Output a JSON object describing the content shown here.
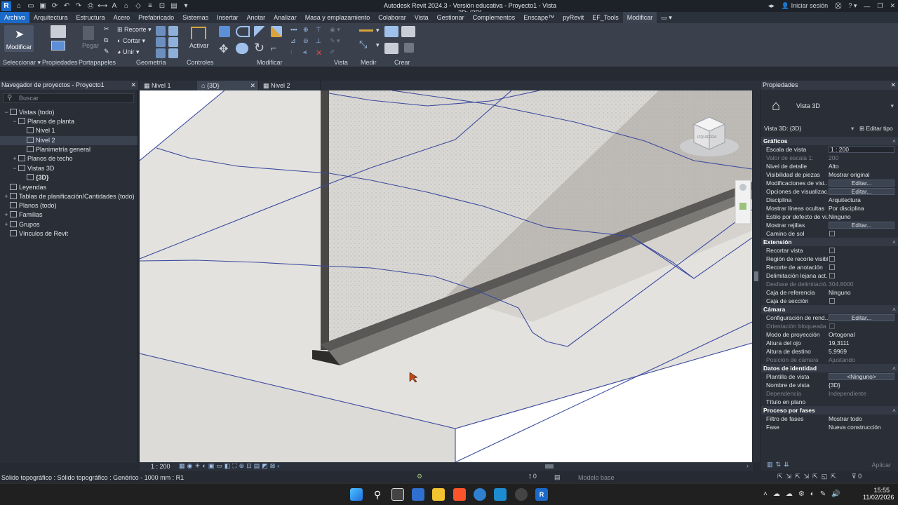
{
  "app": {
    "title": "Autodesk Revit 2024.3 - Versión educativa - Proyecto1 - Vista 3D: {3D}",
    "logo": "R",
    "signin": "Iniciar sesión"
  },
  "menu": [
    "Archivo",
    "Arquitectura",
    "Estructura",
    "Acero",
    "Prefabricado",
    "Sistemas",
    "Insertar",
    "Anotar",
    "Analizar",
    "Masa y emplazamiento",
    "Colaborar",
    "Vista",
    "Gestionar",
    "Complementos",
    "Enscape™",
    "pyRevit",
    "EF_Tools",
    "Modificar"
  ],
  "ribbon": {
    "modify_label": "Modificar",
    "paste_label": "Pegar",
    "cope_label": "Recorte",
    "cut_label": "Cortar",
    "join_label": "Unir",
    "activate_label": "Activar",
    "panels": [
      "Seleccionar",
      "Propiedades",
      "Portapapeles",
      "Geometría",
      "Controles",
      "Modificar",
      "Vista",
      "Medir",
      "Crear"
    ]
  },
  "browser": {
    "title": "Navegador de proyectos - Proyecto1",
    "search_placeholder": "Buscar",
    "items": [
      {
        "label": "Vistas (todo)",
        "toggle": "−",
        "indent": 0
      },
      {
        "label": "Planos de planta",
        "toggle": "−",
        "indent": 1
      },
      {
        "label": "Nivel 1",
        "toggle": "",
        "indent": 2
      },
      {
        "label": "Nivel 2",
        "toggle": "",
        "indent": 2
      },
      {
        "label": "Planimetría general",
        "toggle": "",
        "indent": 2
      },
      {
        "label": "Planos de techo",
        "toggle": "+",
        "indent": 1
      },
      {
        "label": "Vistas 3D",
        "toggle": "−",
        "indent": 1
      },
      {
        "label": "{3D}",
        "toggle": "",
        "indent": 2
      },
      {
        "label": "Leyendas",
        "toggle": "",
        "indent": 0
      },
      {
        "label": "Tablas de planificación/Cantidades (todo)",
        "toggle": "+",
        "indent": 0
      },
      {
        "label": "Planos (todo)",
        "toggle": "",
        "indent": 0
      },
      {
        "label": "Familias",
        "toggle": "+",
        "indent": 0
      },
      {
        "label": "Grupos",
        "toggle": "+",
        "indent": 0
      },
      {
        "label": "Vínculos de Revit",
        "toggle": "",
        "indent": 0
      }
    ]
  },
  "tabs": [
    {
      "label": "Nivel 1"
    },
    {
      "label": "{3D}"
    },
    {
      "label": "Nivel 2"
    }
  ],
  "viewcube": {
    "label": "IZQUIERDA"
  },
  "view_status": {
    "scale": "1 : 200"
  },
  "properties": {
    "title": "Propiedades",
    "type_name": "Vista 3D",
    "selector": "Vista 3D: {3D}",
    "edit_type": "Editar tipo",
    "groups": [
      {
        "name": "Gráficos",
        "rows": [
          {
            "k": "Escala de vista",
            "v": "1 : 200",
            "kind": "field"
          },
          {
            "k": "Valor de escala    1:",
            "v": "200",
            "kind": "dim"
          },
          {
            "k": "Nivel de detalle",
            "v": "Alto"
          },
          {
            "k": "Visibilidad de piezas",
            "v": "Mostrar original"
          },
          {
            "k": "Modificaciones de visi...",
            "v": "Editar...",
            "kind": "btn"
          },
          {
            "k": "Opciones de visualizac...",
            "v": "Editar...",
            "kind": "btn"
          },
          {
            "k": "Disciplina",
            "v": "Arquitectura"
          },
          {
            "k": "Mostrar líneas ocultas",
            "v": "Por disciplina"
          },
          {
            "k": "Estilo por defecto de vi...",
            "v": "Ninguno"
          },
          {
            "k": "Mostrar rejillas",
            "v": "Editar...",
            "kind": "btn"
          },
          {
            "k": "Camino de sol",
            "v": "",
            "kind": "cb"
          }
        ]
      },
      {
        "name": "Extensión",
        "rows": [
          {
            "k": "Recortar vista",
            "v": "",
            "kind": "cb"
          },
          {
            "k": "Región de recorte visible",
            "v": "",
            "kind": "cb"
          },
          {
            "k": "Recorte de anotación",
            "v": "",
            "kind": "cb"
          },
          {
            "k": "Delimitación lejana act...",
            "v": "",
            "kind": "cb"
          },
          {
            "k": "Desfase de delimitació...",
            "v": "304.8000",
            "kind": "dim"
          },
          {
            "k": "Caja de referencia",
            "v": "Ninguno"
          },
          {
            "k": "Caja de sección",
            "v": "",
            "kind": "cb"
          }
        ]
      },
      {
        "name": "Cámara",
        "rows": [
          {
            "k": "Configuración de rend...",
            "v": "Editar...",
            "kind": "btn"
          },
          {
            "k": "Orientación bloqueada",
            "v": "",
            "kind": "dimcb"
          },
          {
            "k": "Modo de proyección",
            "v": "Ortogonal"
          },
          {
            "k": "Altura del ojo",
            "v": "19,3111"
          },
          {
            "k": "Altura de destino",
            "v": "5,9969"
          },
          {
            "k": "Posición de cámara",
            "v": "Ajustando",
            "kind": "dim"
          }
        ]
      },
      {
        "name": "Datos de identidad",
        "rows": [
          {
            "k": "Plantilla de vista",
            "v": "<Ninguno>",
            "kind": "btn"
          },
          {
            "k": "Nombre de vista",
            "v": "{3D}"
          },
          {
            "k": "Dependencia",
            "v": "Independiente",
            "kind": "dim"
          },
          {
            "k": "Título en plano",
            "v": ""
          }
        ]
      },
      {
        "name": "Proceso por fases",
        "rows": [
          {
            "k": "Filtro de fases",
            "v": "Mostrar todo"
          },
          {
            "k": "Fase",
            "v": "Nueva construcción"
          }
        ]
      }
    ],
    "apply": "Aplicar"
  },
  "statusbar": {
    "text": "Sólido topográfico : Sólido topográfico : Genérico - 1000 mm : R1",
    "model": "Modelo base",
    "filter_count": "0"
  },
  "taskbar": {
    "time": "15:55",
    "date": "11/02/2026"
  },
  "colors": {
    "accent": "#1b6ac9",
    "ribbon": "#3a414d",
    "panel": "#2a2f37",
    "grid_line": "#3b4a9e"
  }
}
